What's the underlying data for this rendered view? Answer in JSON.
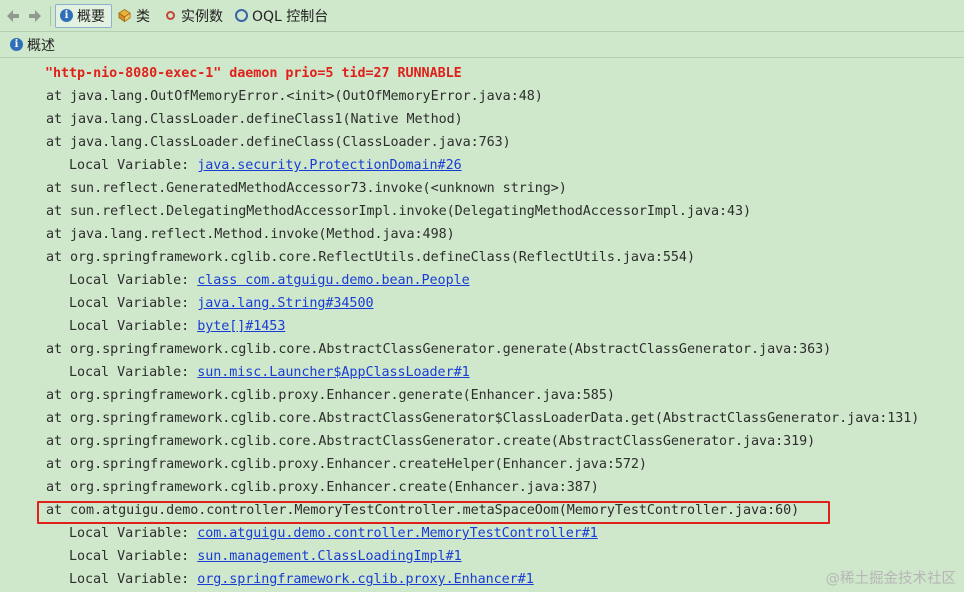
{
  "toolbar": {
    "back_icon": "arrow-left-icon",
    "forward_icon": "arrow-right-icon",
    "tabs": [
      {
        "label": "概要",
        "icon": "info-icon"
      },
      {
        "label": "类",
        "icon": "class-icon"
      },
      {
        "label": "实例数",
        "icon": "instance-icon"
      },
      {
        "label": "OQL 控制台",
        "icon": "oql-icon"
      }
    ]
  },
  "panel": {
    "title": "概述",
    "icon": "info-icon"
  },
  "thread_header": "\"http-nio-8080-exec-1\" daemon prio=5 tid=27 RUNNABLE",
  "stack": [
    {
      "prefix": "at java.lang.OutOfMemoryError.<init>(OutOfMemoryError.java:48)"
    },
    {
      "prefix": "at java.lang.ClassLoader.defineClass1(Native Method)"
    },
    {
      "prefix": "at java.lang.ClassLoader.defineClass(ClassLoader.java:763)"
    },
    {
      "prefix": "Local Variable: ",
      "link": "java.security.ProtectionDomain#26",
      "indent": true
    },
    {
      "prefix": "at sun.reflect.GeneratedMethodAccessor73.invoke(<unknown string>)"
    },
    {
      "prefix": "at sun.reflect.DelegatingMethodAccessorImpl.invoke(DelegatingMethodAccessorImpl.java:43)"
    },
    {
      "prefix": "at java.lang.reflect.Method.invoke(Method.java:498)"
    },
    {
      "prefix": "at org.springframework.cglib.core.ReflectUtils.defineClass(ReflectUtils.java:554)"
    },
    {
      "prefix": "Local Variable: ",
      "link": "class com.atguigu.demo.bean.People",
      "indent": true
    },
    {
      "prefix": "Local Variable: ",
      "link": "java.lang.String#34500",
      "indent": true
    },
    {
      "prefix": "Local Variable: ",
      "link": "byte[]#1453",
      "indent": true
    },
    {
      "prefix": "at org.springframework.cglib.core.AbstractClassGenerator.generate(AbstractClassGenerator.java:363)"
    },
    {
      "prefix": "Local Variable: ",
      "link": "sun.misc.Launcher$AppClassLoader#1",
      "indent": true
    },
    {
      "prefix": "at org.springframework.cglib.proxy.Enhancer.generate(Enhancer.java:585)"
    },
    {
      "prefix": "at org.springframework.cglib.core.AbstractClassGenerator$ClassLoaderData.get(AbstractClassGenerator.java:131)"
    },
    {
      "prefix": "at org.springframework.cglib.core.AbstractClassGenerator.create(AbstractClassGenerator.java:319)"
    },
    {
      "prefix": "at org.springframework.cglib.proxy.Enhancer.createHelper(Enhancer.java:572)"
    },
    {
      "prefix": "at org.springframework.cglib.proxy.Enhancer.create(Enhancer.java:387)"
    },
    {
      "prefix": "at com.atguigu.demo.controller.MemoryTestController.metaSpaceOom(MemoryTestController.java:60)",
      "highlight": true
    },
    {
      "prefix": "Local Variable: ",
      "link": "com.atguigu.demo.controller.MemoryTestController#1",
      "indent": true
    },
    {
      "prefix": "Local Variable: ",
      "link": "sun.management.ClassLoadingImpl#1",
      "indent": true
    },
    {
      "prefix": "Local Variable: ",
      "link": "org.springframework.cglib.proxy.Enhancer#1",
      "indent": true
    }
  ],
  "watermark": "@稀土掘金技术社区",
  "colors": {
    "background": "#cfe8cb",
    "thread": "#e0201b",
    "link": "#1a3cd6",
    "highlight_border": "#e0201b"
  }
}
